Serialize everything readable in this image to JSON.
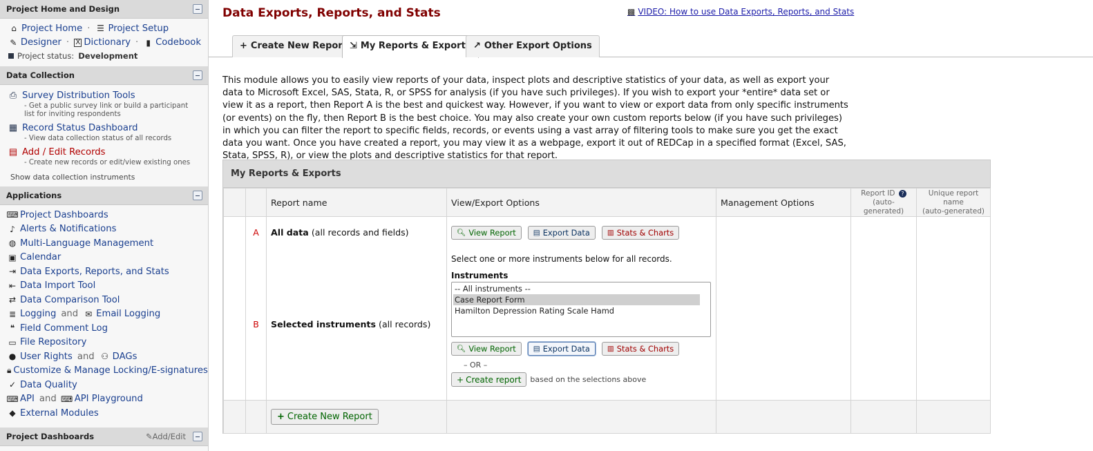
{
  "sidebar": {
    "sections": {
      "home": {
        "title": "Project Home and Design"
      },
      "data_collection": {
        "title": "Data Collection"
      },
      "applications": {
        "title": "Applications"
      },
      "dashboards": {
        "title": "Project Dashboards",
        "add_edit": "Add/Edit"
      }
    },
    "home_links": {
      "project_home": "Project Home",
      "project_setup": "Project Setup",
      "designer": "Designer",
      "dictionary": "Dictionary",
      "codebook": "Codebook",
      "sep": "·",
      "status_label": "Project status:",
      "status_value": "Development"
    },
    "data_collection": {
      "items": [
        {
          "title": "Survey Distribution Tools",
          "desc": "- Get a public survey link or build a participant list for inviting respondents"
        },
        {
          "title": "Record Status Dashboard",
          "desc": "- View data collection status of all records"
        },
        {
          "title": "Add / Edit Records",
          "desc": "- Create new records or edit/view existing ones"
        }
      ],
      "show_instruments": "Show data collection instruments"
    },
    "applications": {
      "project_dashboards": "Project Dashboards",
      "alerts": "Alerts & Notifications",
      "multilang": "Multi-Language Management",
      "calendar": "Calendar",
      "data_exports": "Data Exports, Reports, and Stats",
      "data_import": "Data Import Tool",
      "data_comparison": "Data Comparison Tool",
      "logging": "Logging",
      "and": "and",
      "email_logging": "Email Logging",
      "field_comment": "Field Comment Log",
      "file_repo": "File Repository",
      "user_rights": "User Rights",
      "dags": "DAGs",
      "locking": "Customize & Manage Locking/E-signatures",
      "data_quality": "Data Quality",
      "api": "API",
      "api_playground": "API Playground",
      "external_modules": "External Modules"
    }
  },
  "main": {
    "title": "Data Exports, Reports, and Stats",
    "video_link": "VIDEO: How to use Data Exports, Reports, and Stats",
    "tabs": {
      "create": "Create New Report",
      "my_reports": "My Reports & Exports",
      "other": "Other Export Options"
    },
    "intro": "This module allows you to easily view reports of your data, inspect plots and descriptive statistics of your data, as well as export your data to Microsoft Excel, SAS, Stata, R, or SPSS for analysis (if you have such privileges). If you wish to export your *entire* data set or view it as a report, then Report A is the best and quickest way. However, if you want to view or export data from only specific instruments (or events) on the fly, then Report B is the best choice. You may also create your own custom reports below (if you have such privileges) in which you can filter the report to specific fields, records, or events using a vast array of filtering tools to make sure you get the exact data you want. Once you have created a report, you may view it as a webpage, export it out of REDCap in a specified format (Excel, SAS, Stata, SPSS, R), or view the plots and descriptive statistics for that report."
  },
  "reports": {
    "panel_title": "My Reports & Exports",
    "headers": {
      "name": "Report name",
      "view_export": "View/Export Options",
      "management": "Management Options",
      "report_id": "Report ID",
      "report_id_sub": "(auto-generated)",
      "unique_name": "Unique report name",
      "unique_name_sub": "(auto-generated)"
    },
    "row_a": {
      "letter": "A",
      "name_bold": "All data",
      "name_rest": "(all records and fields)"
    },
    "row_b": {
      "letter": "B",
      "name_bold": "Selected instruments",
      "name_rest": "(all records)",
      "select_prompt": "Select one or more instruments below for all records.",
      "instruments_label": "Instruments",
      "options": [
        "-- All instruments --",
        "Case Report Form",
        "Hamilton Depression Rating Scale Hamd"
      ],
      "selected_option": "Case Report Form",
      "or_text": "– OR –",
      "create_report": "Create report",
      "based_on": "based on the selections above"
    },
    "buttons": {
      "view": "View Report",
      "export": "Export Data",
      "stats": "Stats & Charts"
    },
    "create_new": "Create New Report"
  }
}
